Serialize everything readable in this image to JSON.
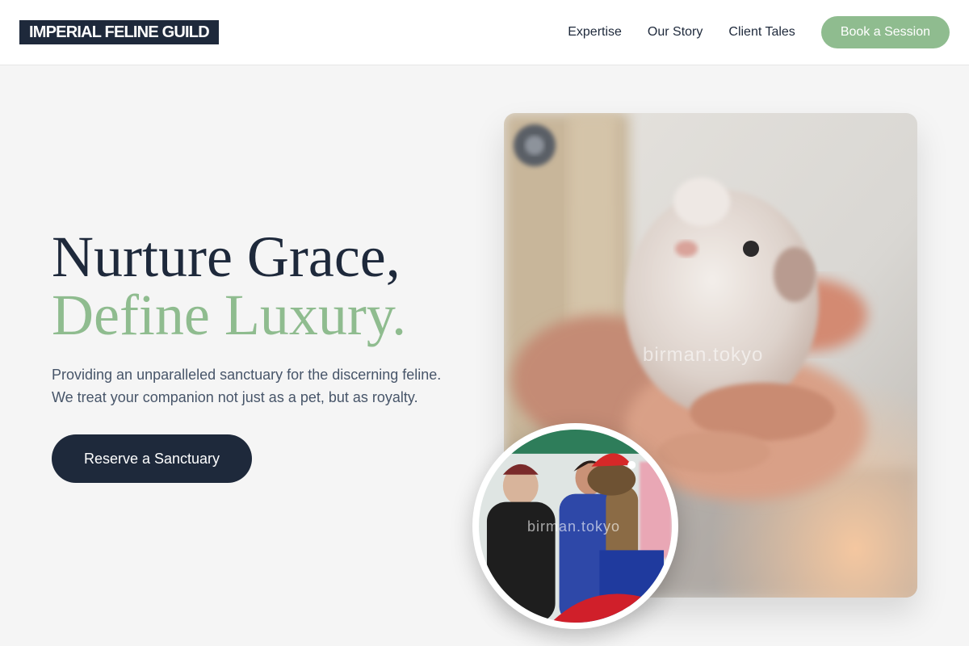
{
  "brand": {
    "logo_text": "IMPERIAL FELINE GUILD"
  },
  "nav": {
    "links": [
      "Expertise",
      "Our Story",
      "Client Tales"
    ],
    "cta_label": "Book a Session"
  },
  "hero": {
    "title_line1": "Nurture Grace,",
    "title_line2": "Define Luxury.",
    "subtitle_line1": "Providing an unparalleled sanctuary for the discerning feline.",
    "subtitle_line2": "We treat your companion not just as a pet, but as royalty.",
    "cta_label": "Reserve a Sanctuary"
  },
  "images": {
    "main_watermark": "birman.tokyo",
    "inset_watermark": "birman.tokyo"
  },
  "colors": {
    "navy": "#1e293b",
    "sage": "#8fbc8f",
    "background": "#f5f5f5",
    "text_muted": "#475569"
  }
}
